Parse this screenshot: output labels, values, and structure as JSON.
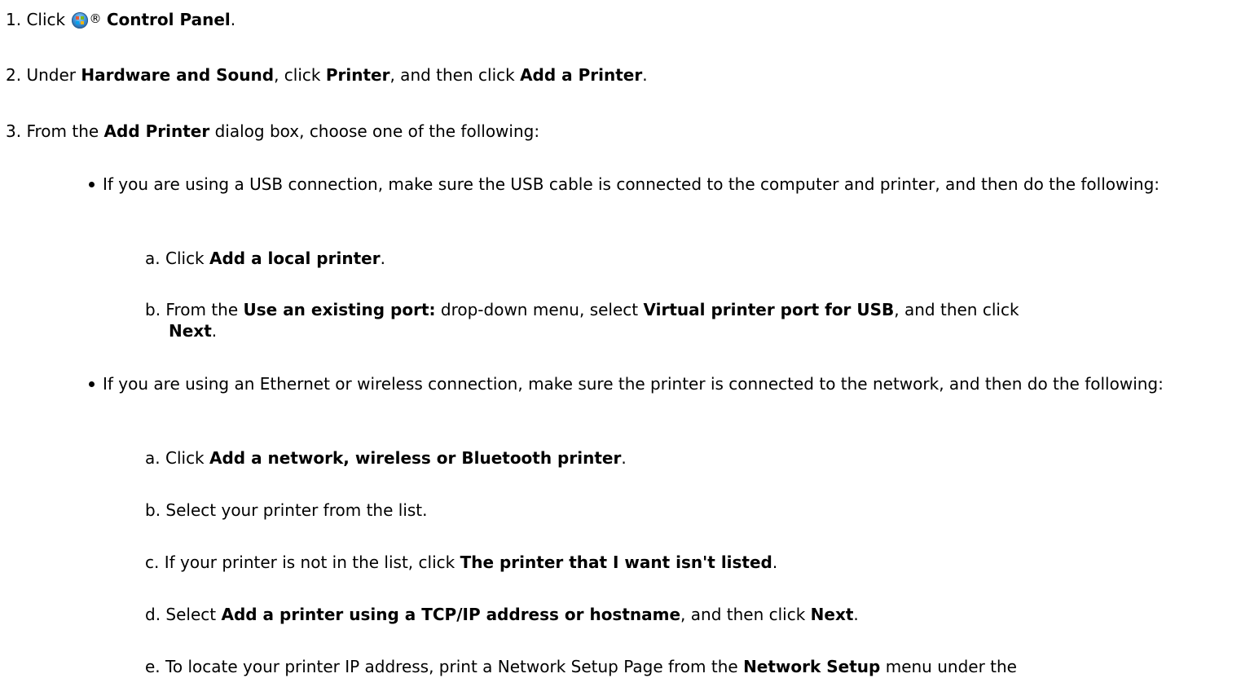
{
  "steps": {
    "s1": {
      "num": "1.",
      "pre": "Click ",
      "reg": "®",
      "bold": "Control Panel",
      "post": "."
    },
    "s2": {
      "num": "2.",
      "t1": "Under ",
      "b1": "Hardware and Sound",
      "t2": ", click ",
      "b2": "Printer",
      "t3": ", and then click ",
      "b3": "Add a Printer",
      "t4": "."
    },
    "s3": {
      "num": "3.",
      "t1": "From the ",
      "b1": "Add Printer",
      "t2": " dialog box, choose one of the following:"
    }
  },
  "usb": {
    "intro": "If you are using a USB connection, make sure the USB cable is connected to the computer and printer, and then do the following:",
    "a": {
      "letter": "a.",
      "t1": "Click ",
      "b1": "Add a local printer",
      "t2": "."
    },
    "b": {
      "letter": "b.",
      "t1": "From the ",
      "b1": "Use an existing port:",
      "t2": " drop-down menu, select ",
      "b2": "Virtual printer port for USB",
      "t3": ", and then click",
      "b3": "Next",
      "t4": "."
    }
  },
  "net": {
    "intro": "If you are using an Ethernet or wireless connection, make sure the printer is connected to the network, and then do the following:",
    "a": {
      "letter": "a.",
      "t1": "Click ",
      "b1": "Add a network, wireless or Bluetooth printer",
      "t2": "."
    },
    "b": {
      "letter": "b.",
      "t1": "Select your printer from the list."
    },
    "c": {
      "letter": "c.",
      "t1": "If your printer is not in the list, click ",
      "b1": "The printer that I want isn't listed",
      "t2": "."
    },
    "d": {
      "letter": "d.",
      "t1": "Select ",
      "b1": "Add a printer using a TCP/IP address or hostname",
      "t2": ", and then click ",
      "b2": "Next",
      "t3": "."
    },
    "e": {
      "letter": "e.",
      "t1": "To locate your printer IP address, print a Network Setup Page from the ",
      "b1": "Network Setup",
      "t2": " menu under the"
    }
  },
  "icons": {
    "start": "windows-start-orb-icon"
  }
}
